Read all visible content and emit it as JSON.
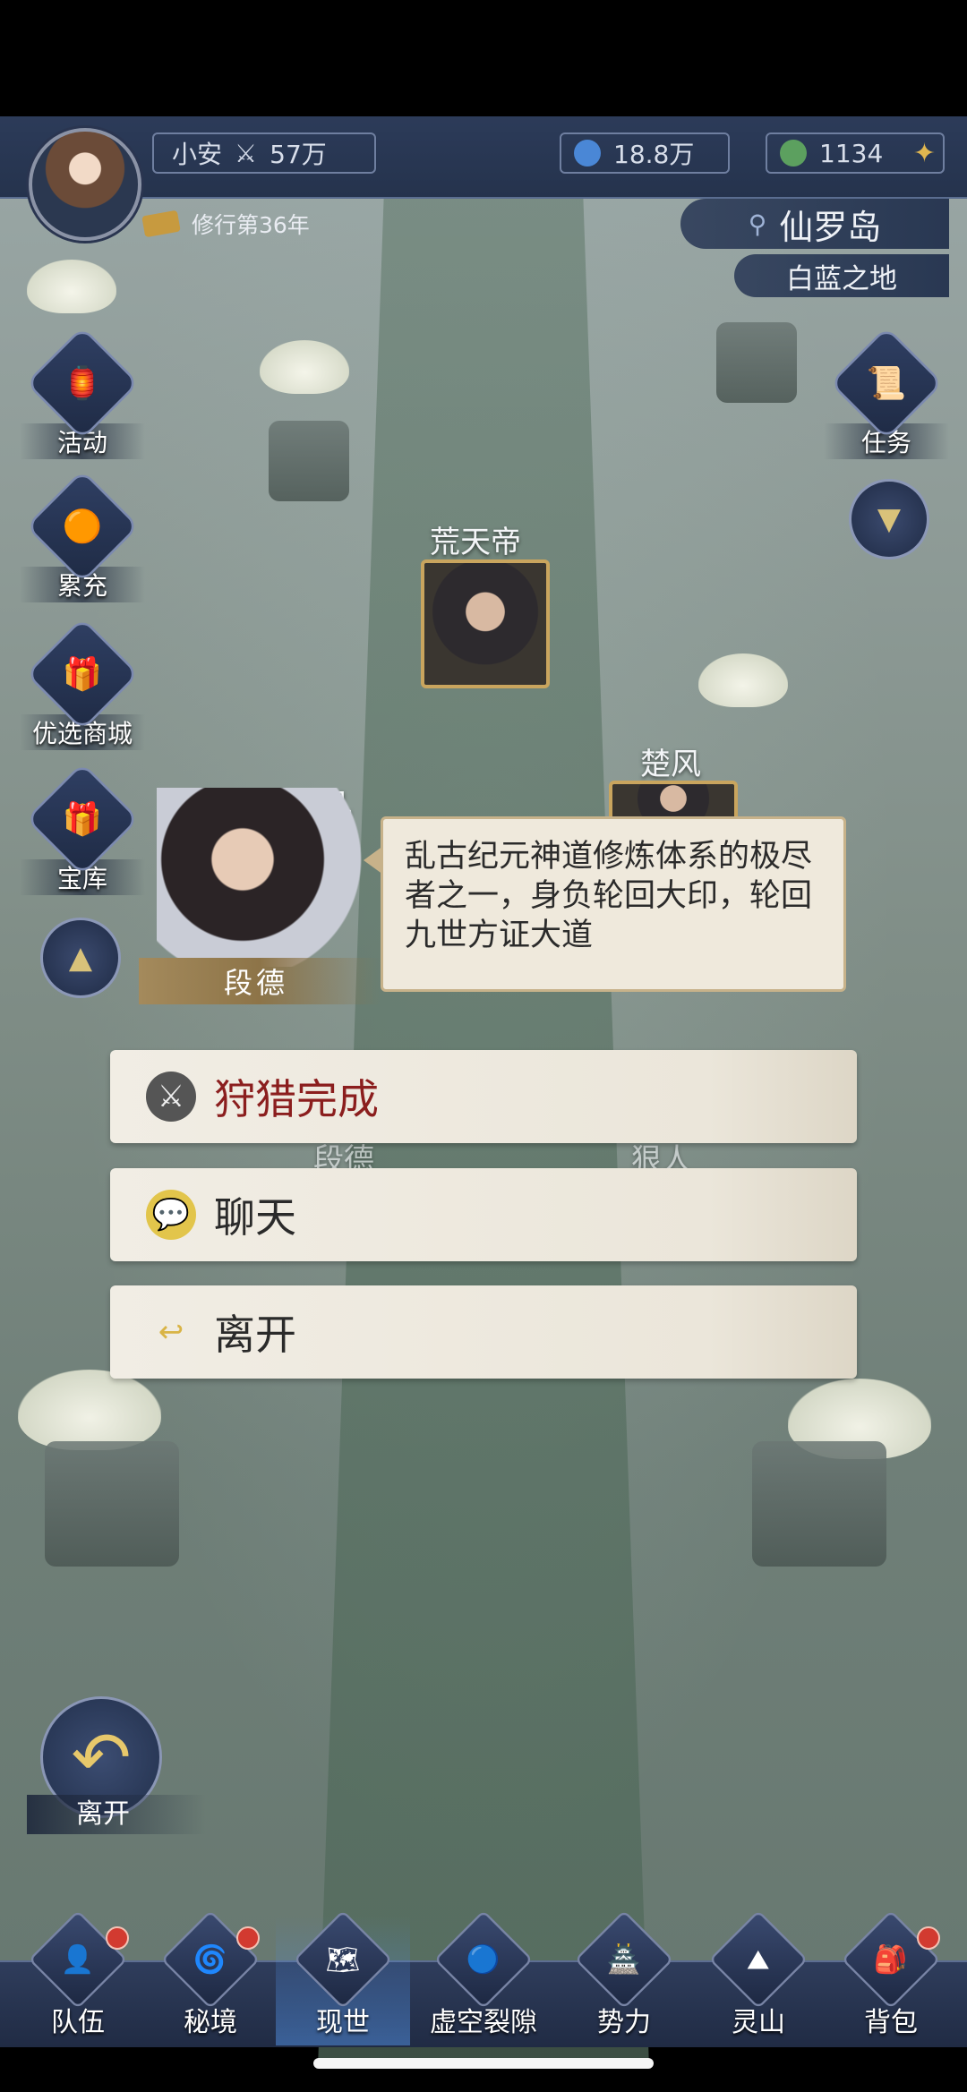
{
  "player": {
    "name": "小安",
    "power": "57万"
  },
  "resources": {
    "crystal": "18.8万",
    "jade": "1134"
  },
  "cultivation": "修行第36年",
  "location": {
    "main": "仙罗岛",
    "sub": "白蓝之地"
  },
  "side_menu": {
    "activity": "活动",
    "recharge": "累充",
    "shop": "优选商城",
    "treasury": "宝库",
    "quest": "任务"
  },
  "map_characters": {
    "huangtiandi": "荒天帝",
    "yefan": "叶凡",
    "chufeng": "楚风",
    "duande_map": "段德",
    "langren": "狠人"
  },
  "dialog": {
    "speaker": "段德",
    "text": "乱古纪元神道修炼体系的极尽者之一，身负轮回大印，轮回九世方证大道",
    "options": [
      "狩猎完成",
      "聊天",
      "离开"
    ]
  },
  "leave_button": "离开",
  "bottom_nav": [
    "队伍",
    "秘境",
    "现世",
    "虚空裂隙",
    "势力",
    "灵山",
    "背包"
  ],
  "icons": {
    "hunt": "sword-icon",
    "chat": "speech-bubble-icon",
    "leave": "return-arrow-icon"
  }
}
